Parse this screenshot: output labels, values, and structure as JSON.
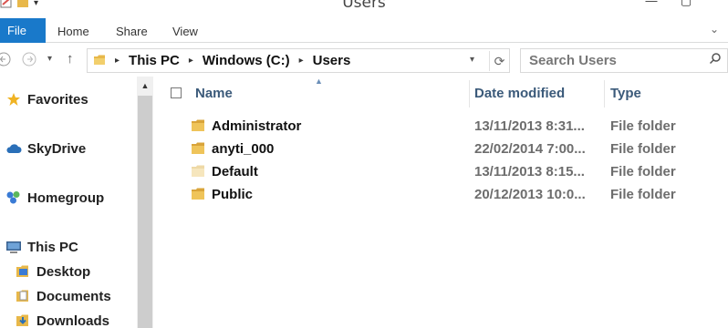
{
  "window": {
    "title": "Users"
  },
  "ribbon": {
    "tabs": [
      "File",
      "Home",
      "Share",
      "View"
    ]
  },
  "address": {
    "crumbs": [
      "This PC",
      "Windows (C:)",
      "Users"
    ]
  },
  "search": {
    "placeholder": "Search Users"
  },
  "nav": {
    "items": [
      {
        "label": "Favorites",
        "icon": "star-icon"
      },
      {
        "label": "SkyDrive",
        "icon": "cloud-icon"
      },
      {
        "label": "Homegroup",
        "icon": "homegroup-icon"
      },
      {
        "label": "This PC",
        "icon": "computer-icon"
      },
      {
        "label": "Desktop",
        "icon": "desktop-folder-icon"
      },
      {
        "label": "Documents",
        "icon": "documents-folder-icon"
      },
      {
        "label": "Downloads",
        "icon": "downloads-folder-icon"
      }
    ]
  },
  "list": {
    "columns": {
      "name": "Name",
      "date": "Date modified",
      "type": "Type"
    },
    "rows": [
      {
        "name": "Administrator",
        "date": "13/11/2013 8:31...",
        "type": "File folder"
      },
      {
        "name": "anyti_000",
        "date": "22/02/2014 7:00...",
        "type": "File folder"
      },
      {
        "name": "Default",
        "date": "13/11/2013 8:15...",
        "type": "File folder"
      },
      {
        "name": "Public",
        "date": "20/12/2013 10:0...",
        "type": "File folder"
      }
    ]
  },
  "colors": {
    "accent": "#1979ca",
    "folder": "#e8b84a",
    "header_text": "#3b5a7a"
  }
}
